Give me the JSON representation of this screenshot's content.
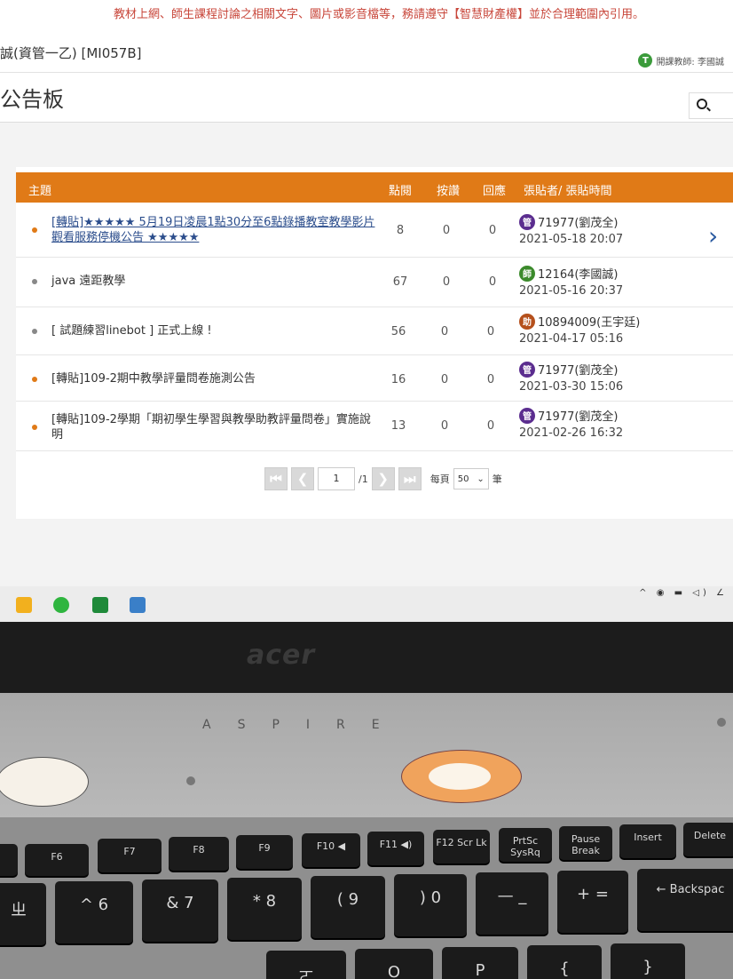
{
  "notice": "教材上網、師生課程討論之相關文字、圖片或影音檔等，務請遵守【智慧財產權】並於合理範圍內引用。",
  "course": {
    "name": "誠(資管一乙) [MI057B]",
    "teacher_badge": "T",
    "teacher_label": "開課教師: 李國誠"
  },
  "page_title": "公告板",
  "table": {
    "headers": {
      "topic": "主題",
      "views": "點閱",
      "likes": "按讚",
      "replies": "回應",
      "poster": "張貼者/ 張貼時間"
    },
    "rows": [
      {
        "bullet_color": "#e07a17",
        "topic": "[轉貼]★★★★★ 5月19日凌晨1點30分至6點錄播教室教學影片觀看服務停機公告 ★★★★★",
        "views": "8",
        "likes": "0",
        "replies": "0",
        "role": "管",
        "role_color": "#5b2d8f",
        "poster": "71977(劉茂全)",
        "time": "2021-05-18 20:07"
      },
      {
        "bullet_color": "#888888",
        "topic": "java 遠距教學",
        "views": "67",
        "likes": "0",
        "replies": "0",
        "role": "師",
        "role_color": "#3b8a2b",
        "poster": "12164(李國誠)",
        "time": "2021-05-16 20:37"
      },
      {
        "bullet_color": "#888888",
        "topic": "[ 試題練習linebot ] 正式上線 !",
        "views": "56",
        "likes": "0",
        "replies": "0",
        "role": "助",
        "role_color": "#b5501c",
        "poster": "10894009(王宇廷)",
        "time": "2021-04-17 05:16"
      },
      {
        "bullet_color": "#e07a17",
        "topic": "[轉貼]109-2期中教學評量問卷施測公告",
        "views": "16",
        "likes": "0",
        "replies": "0",
        "role": "管",
        "role_color": "#5b2d8f",
        "poster": "71977(劉茂全)",
        "time": "2021-03-30 15:06"
      },
      {
        "bullet_color": "#e07a17",
        "topic": "[轉貼]109-2學期「期初學生學習與教學助教評量問卷」實施說明",
        "views": "13",
        "likes": "0",
        "replies": "0",
        "role": "管",
        "role_color": "#5b2d8f",
        "poster": "71977(劉茂全)",
        "time": "2021-02-26 16:32"
      }
    ]
  },
  "pager": {
    "first": "⏮",
    "prev": "❮",
    "page": "1",
    "total": "/1",
    "next": "❯",
    "last": "⏭",
    "per_page_label": "每頁",
    "per_page_value": "50",
    "per_page_unit": "筆"
  },
  "tray": "^ ◉ ▬ ◁) ∠",
  "laptop": {
    "brand": "acer",
    "model": "ASPIRE",
    "fn_keys": [
      {
        "label": "F6"
      },
      {
        "label": "F7"
      },
      {
        "label": "F8"
      },
      {
        "label": "F9"
      },
      {
        "label": "F10 ◀"
      },
      {
        "label": "F11 ◀)"
      },
      {
        "label": "F12 Scr Lk"
      },
      {
        "label": "PrtSc SysRq"
      },
      {
        "label": "Pause Break"
      },
      {
        "label": "Insert"
      },
      {
        "label": "Delete"
      }
    ],
    "num_keys": [
      {
        "label": "ㄓ"
      },
      {
        "label": "^ 6"
      },
      {
        "label": "& 7"
      },
      {
        "label": "* 8"
      },
      {
        "label": "( 9"
      },
      {
        "label": ") 0"
      },
      {
        "label": "— _"
      },
      {
        "label": "+ ="
      },
      {
        "label": "← Backspac"
      }
    ],
    "bottom_keys": [
      {
        "label": "ㄛ"
      },
      {
        "label": "O"
      },
      {
        "label": "P"
      },
      {
        "label": "{"
      },
      {
        "label": "}"
      }
    ]
  }
}
